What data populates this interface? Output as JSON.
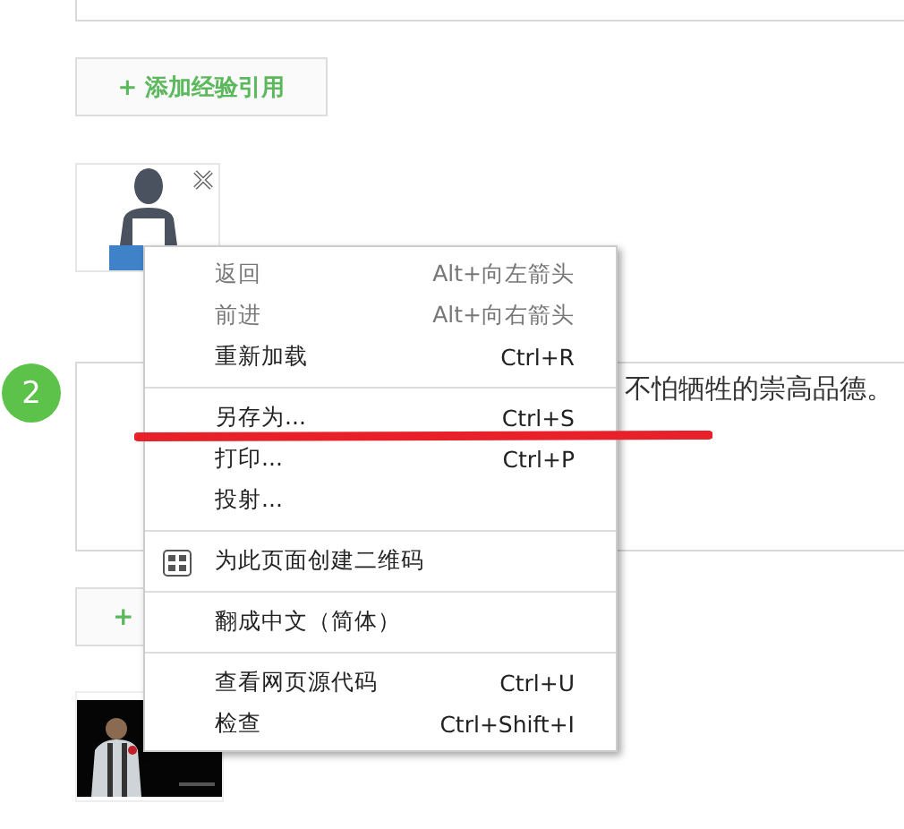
{
  "add_button": {
    "label": "+ 添加经验引用"
  },
  "step": {
    "number": "2",
    "text": "不怕牺牲的崇高品德。"
  },
  "add_button_2": {
    "label": "+"
  },
  "context_menu": {
    "groups": [
      {
        "items": [
          {
            "label": "返回",
            "shortcut": "Alt+向左箭头",
            "disabled": true
          },
          {
            "label": "前进",
            "shortcut": "Alt+向右箭头",
            "disabled": true
          },
          {
            "label": "重新加载",
            "shortcut": "Ctrl+R",
            "disabled": false
          }
        ]
      },
      {
        "items": [
          {
            "label": "另存为...",
            "shortcut": "Ctrl+S",
            "disabled": false
          },
          {
            "label": "打印...",
            "shortcut": "Ctrl+P",
            "disabled": false
          },
          {
            "label": "投射...",
            "disabled": false
          }
        ]
      },
      {
        "items": [
          {
            "label": "为此页面创建二维码",
            "kind": "with-icon",
            "disabled": false
          }
        ]
      },
      {
        "items": [
          {
            "label": "翻成中文（简体）",
            "disabled": false
          }
        ]
      },
      {
        "items": [
          {
            "label": "查看网页源代码",
            "shortcut": "Ctrl+U",
            "disabled": false
          },
          {
            "label": "检查",
            "shortcut": "Ctrl+Shift+I",
            "disabled": false
          }
        ]
      }
    ]
  }
}
